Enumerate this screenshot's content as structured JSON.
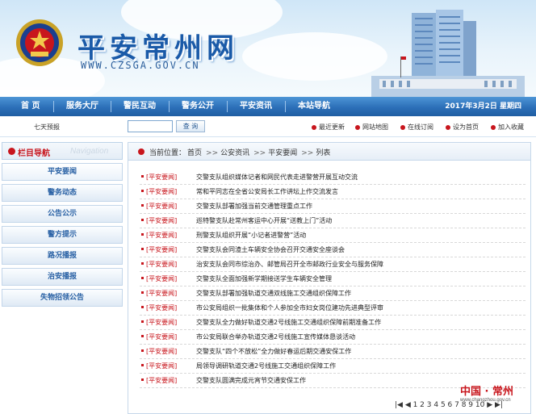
{
  "header": {
    "site_title": "平安常州网",
    "site_url": "WWW.CZSGA.GOV.CN"
  },
  "nav": {
    "items": [
      "首 页",
      "服务大厅",
      "警民互动",
      "警务公开",
      "平安资讯",
      "本站导航"
    ],
    "date": "2017年3月2日  星期四"
  },
  "toolbar": {
    "weather_label": "七天预报",
    "search_placeholder": "",
    "search_button": "查 询",
    "links": [
      "最近更新",
      "网站地图",
      "在线订阅",
      "设为首页",
      "加入收藏"
    ]
  },
  "sidebar": {
    "title": "栏目导航",
    "title_en": "Navigation",
    "items": [
      "平安要闻",
      "警务动态",
      "公告公示",
      "警方提示",
      "路况播报",
      "治安播报",
      "失物招领公告"
    ]
  },
  "breadcrumb": {
    "prefix": "当前位置：",
    "items": [
      "首页",
      "公安资讯",
      "平安要闻",
      "列表"
    ],
    "separator": ">>"
  },
  "news": {
    "tag": "[平安要闻]",
    "items": [
      "交警支队组织媒体记者和网民代表走进警营开展互动交流",
      "常和平同志在全省公安局长工作讲坛上作交流发言",
      "交警支队部署加强当前交通管理重点工作",
      "巡特警支队赴常州客运中心开展“送教上门”活动",
      "刑警支队组织开展“小记者进警营”活动",
      "交警支队会同渣土车辆安全协会召开交通安全座谈会",
      "治安支队会同市综治办、邮管局召开全市邮政行业安全与服务保障",
      "交警支队全面加强新学期接送学生车辆安全管理",
      "交警支队部署加强轨道交通双线施工交通组织保障工作",
      "市公安局组织一批集体和个人参加全市妇女岗位建功先进典型评审",
      "交警支队全力做好轨道交通2号线施工交通组织保障前期准备工作",
      "市公安局联合举办轨道交通2号线施工宣传媒体恳谈活动",
      "交警支队“四个不放松”全力做好春运后期交通安保工作",
      "局领导调研轨道交通2号线施工交通组织保障工作",
      "交警支队圆满完成元宵节交通安保工作"
    ]
  },
  "pager": {
    "text": "|◀ ◀ 1 2 3 4 5 6 7 8 9 10 ▶ ▶|"
  },
  "footer": {
    "logo_cn": "中国 · 常州",
    "logo_url": "www.changzhou.gov.cn"
  },
  "colors": {
    "nav_blue": "#2c6fb8",
    "accent_red": "#c8161d",
    "link_blue": "#2860a4"
  }
}
